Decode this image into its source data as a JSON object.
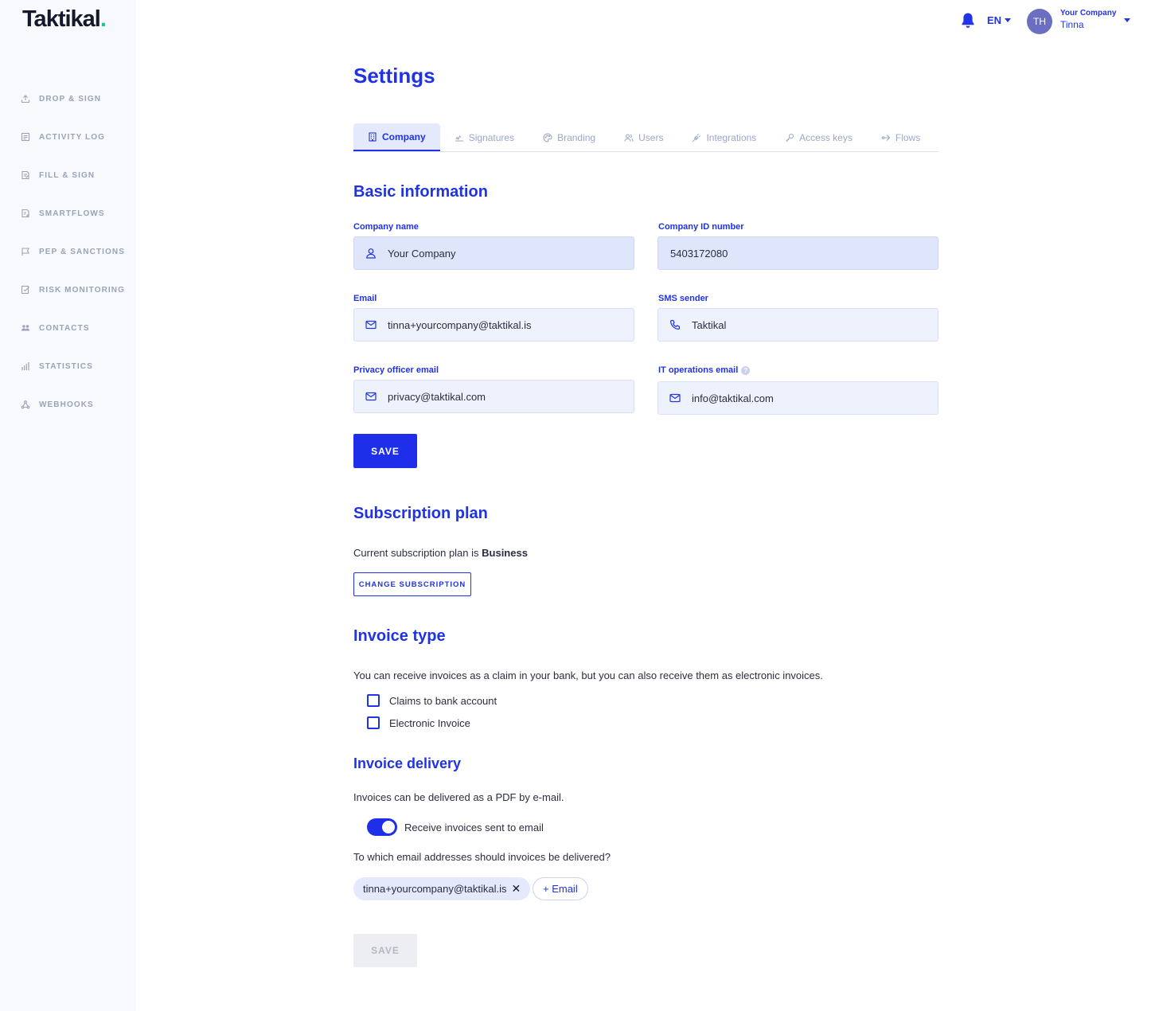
{
  "app": {
    "logo": "Taktikal",
    "logo_dot": "."
  },
  "sidebar": {
    "items": [
      {
        "label": "DROP & SIGN",
        "icon": "upload-icon"
      },
      {
        "label": "ACTIVITY LOG",
        "icon": "log-icon"
      },
      {
        "label": "FILL & SIGN",
        "icon": "form-icon"
      },
      {
        "label": "SMARTFLOWS",
        "icon": "flow-icon"
      },
      {
        "label": "PEP & SANCTIONS",
        "icon": "flag-icon"
      },
      {
        "label": "RISK MONITORING",
        "icon": "checklist-icon"
      },
      {
        "label": "CONTACTS",
        "icon": "people-icon"
      },
      {
        "label": "STATISTICS",
        "icon": "bar-chart-icon"
      },
      {
        "label": "WEBHOOKS",
        "icon": "webhook-icon"
      }
    ]
  },
  "topbar": {
    "language": "EN",
    "avatar_initials": "TH",
    "company": "Your Company",
    "user_name": "Tinna"
  },
  "page": {
    "title": "Settings"
  },
  "tabs": [
    {
      "label": "Company",
      "icon": "building-icon",
      "active": true
    },
    {
      "label": "Signatures",
      "icon": "signature-icon",
      "active": false
    },
    {
      "label": "Branding",
      "icon": "palette-icon",
      "active": false
    },
    {
      "label": "Users",
      "icon": "users-icon",
      "active": false
    },
    {
      "label": "Integrations",
      "icon": "plug-icon",
      "active": false
    },
    {
      "label": "Access keys",
      "icon": "key-icon",
      "active": false
    },
    {
      "label": "Flows",
      "icon": "share-icon",
      "active": false
    }
  ],
  "basic_info": {
    "heading": "Basic information",
    "company_name_label": "Company name",
    "company_name_value": "Your Company",
    "company_id_label": "Company ID number",
    "company_id_value": "5403172080",
    "email_label": "Email",
    "email_value": "tinna+yourcompany@taktikal.is",
    "sms_label": "SMS sender",
    "sms_value": "Taktikal",
    "privacy_label": "Privacy officer email",
    "privacy_value": "privacy@taktikal.com",
    "it_label": "IT operations email",
    "it_help": "?",
    "it_value": "info@taktikal.com",
    "save_label": "SAVE"
  },
  "subscription": {
    "heading": "Subscription plan",
    "text_prefix": "Current subscription plan is ",
    "plan": "Business",
    "change_label": "CHANGE SUBSCRIPTION"
  },
  "invoice_type": {
    "heading": "Invoice type",
    "description": "You can receive invoices as a claim in your bank, but you can also receive them as electronic invoices.",
    "option_claims": "Claims to bank account",
    "option_electronic": "Electronic Invoice"
  },
  "invoice_delivery": {
    "heading": "Invoice delivery",
    "description": "Invoices can be delivered as a PDF by e-mail.",
    "toggle_label": "Receive invoices sent to email",
    "toggle_on": true,
    "question": "To which email addresses should invoices be delivered?",
    "emails": [
      "tinna+yourcompany@taktikal.is"
    ],
    "remove_symbol": "✕",
    "add_email_label": "+ Email",
    "save_label": "SAVE"
  },
  "colors": {
    "accent": "#1f33e4",
    "sidebar_bg": "#f7f9fc",
    "field_bg": "#eef2fc",
    "success_dot": "#19c98b"
  }
}
